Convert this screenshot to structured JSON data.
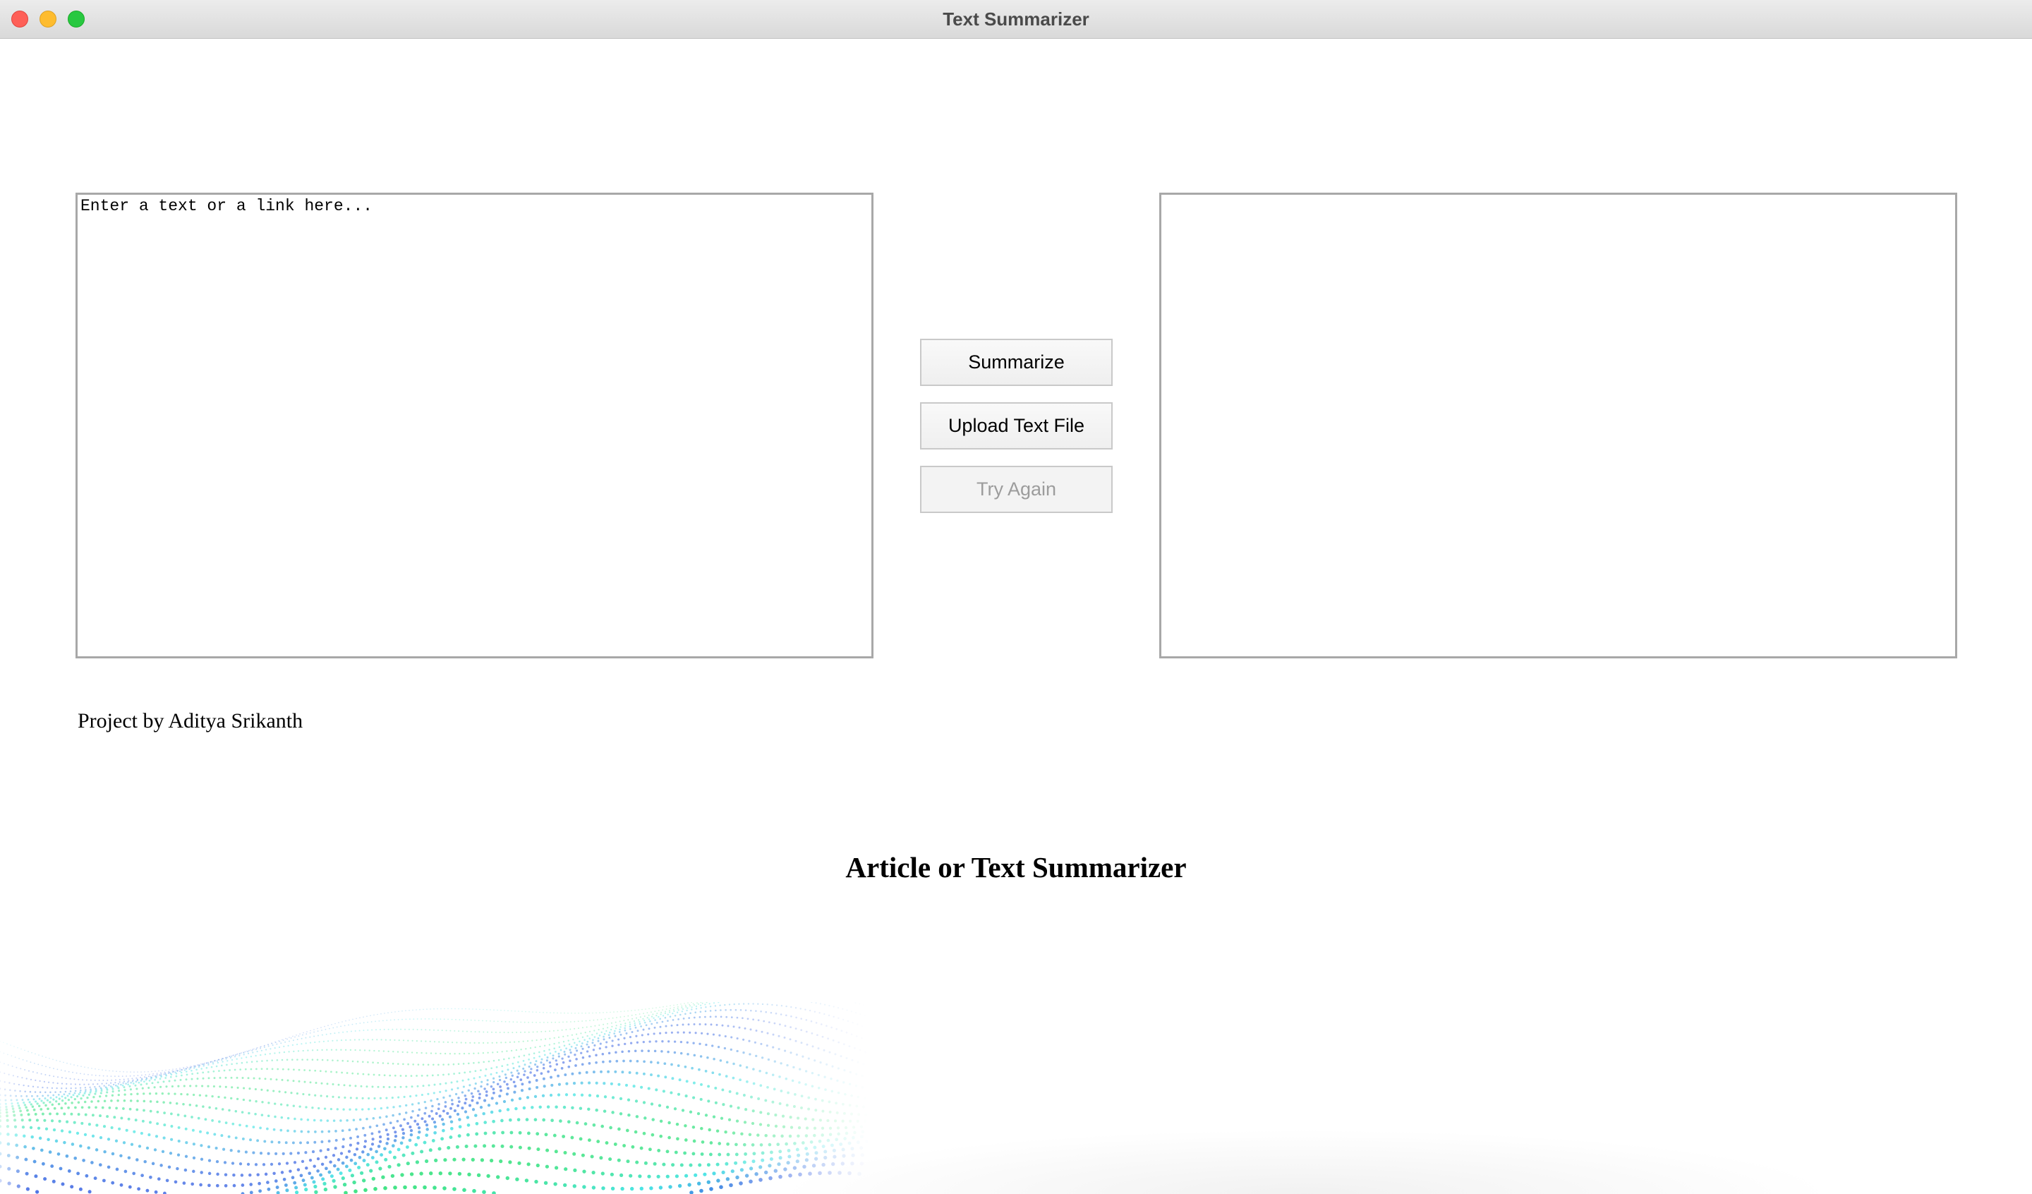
{
  "window": {
    "title": "Text Summarizer"
  },
  "input": {
    "placeholder": "Enter a text or a link here...",
    "value": ""
  },
  "output": {
    "value": ""
  },
  "buttons": {
    "summarize": "Summarize",
    "upload": "Upload Text File",
    "try_again": "Try Again"
  },
  "footer": {
    "credit": "Project by Aditya Srikanth",
    "heading": "Article or Text Summarizer"
  },
  "colors": {
    "close": "#fe5f57",
    "minimize": "#febc2e",
    "maximize": "#28c840",
    "disabled_text": "#9c9c9c"
  }
}
